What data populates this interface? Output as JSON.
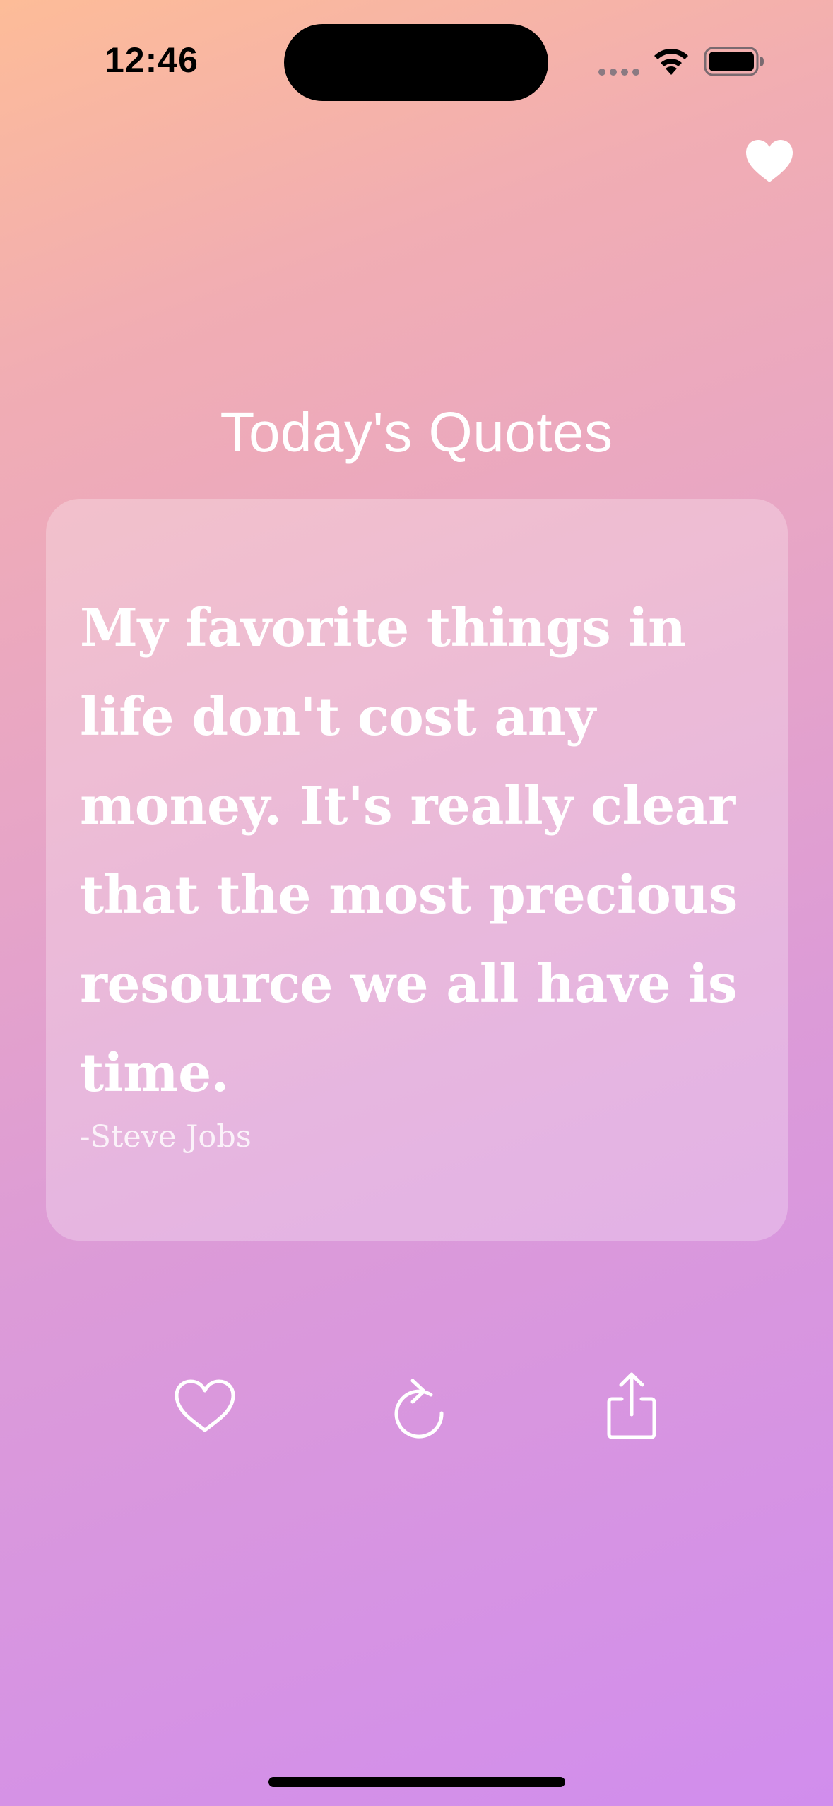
{
  "status_bar": {
    "time": "12:46"
  },
  "header": {
    "favorites_icon": "heart-filled-icon"
  },
  "main": {
    "title": "Today's Quotes",
    "quote": {
      "text": "My favorite things in life don't cost any money. It's really clear that the most precious resource we all have is time.",
      "author": "-Steve Jobs"
    }
  },
  "actions": [
    {
      "name": "like",
      "icon": "heart-outline-icon"
    },
    {
      "name": "refresh",
      "icon": "refresh-icon"
    },
    {
      "name": "share",
      "icon": "share-icon"
    }
  ],
  "colors": {
    "gradient_top": "#fdbc98",
    "gradient_bottom": "#d18ded",
    "text": "#ffffff"
  }
}
